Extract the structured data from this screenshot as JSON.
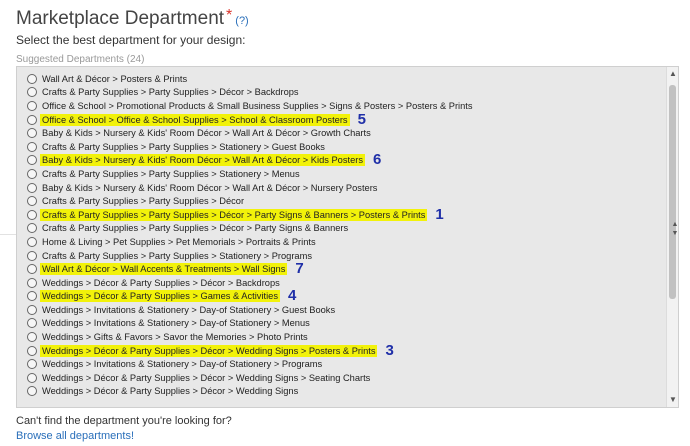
{
  "header": {
    "title": "Marketplace Department",
    "required_mark": "*",
    "help_link": "(?)"
  },
  "instruction": "Select the best department for your design:",
  "suggested_label": "Suggested Departments (24)",
  "colors": {
    "highlight": "#f2f20a",
    "badge": "#1f2fa8",
    "link": "#2a6fba",
    "required": "#d9342b"
  },
  "departments": [
    {
      "label": "Wall Art & Décor > Posters & Prints",
      "highlighted": false,
      "badge": ""
    },
    {
      "label": "Crafts & Party Supplies > Party Supplies > Décor > Backdrops",
      "highlighted": false,
      "badge": ""
    },
    {
      "label": "Office & School > Promotional Products & Small Business Supplies > Signs & Posters > Posters & Prints",
      "highlighted": false,
      "badge": ""
    },
    {
      "label": "Office & School > Office & School Supplies > School & Classroom Posters",
      "highlighted": true,
      "badge": "5"
    },
    {
      "label": "Baby & Kids > Nursery & Kids' Room Décor > Wall Art & Décor > Growth Charts",
      "highlighted": false,
      "badge": ""
    },
    {
      "label": "Crafts & Party Supplies > Party Supplies > Stationery > Guest Books",
      "highlighted": false,
      "badge": ""
    },
    {
      "label": "Baby & Kids > Nursery & Kids' Room Décor > Wall Art & Décor > Kids Posters",
      "highlighted": true,
      "badge": "6"
    },
    {
      "label": "Crafts & Party Supplies > Party Supplies > Stationery > Menus",
      "highlighted": false,
      "badge": ""
    },
    {
      "label": "Baby & Kids > Nursery & Kids' Room Décor > Wall Art & Décor > Nursery Posters",
      "highlighted": false,
      "badge": ""
    },
    {
      "label": "Crafts & Party Supplies > Party Supplies > Décor",
      "highlighted": false,
      "badge": ""
    },
    {
      "label": "Crafts & Party Supplies > Party Supplies > Décor > Party Signs & Banners > Posters & Prints",
      "highlighted": true,
      "badge": "1"
    },
    {
      "label": "Crafts & Party Supplies > Party Supplies > Décor > Party Signs & Banners",
      "highlighted": false,
      "badge": ""
    },
    {
      "label": "Home & Living > Pet Supplies > Pet Memorials > Portraits & Prints",
      "highlighted": false,
      "badge": ""
    },
    {
      "label": "Crafts & Party Supplies > Party Supplies > Stationery > Programs",
      "highlighted": false,
      "badge": ""
    },
    {
      "label": "Wall Art & Décor > Wall Accents & Treatments > Wall Signs",
      "highlighted": true,
      "badge": "7"
    },
    {
      "label": "Weddings > Décor & Party Supplies > Décor > Backdrops",
      "highlighted": false,
      "badge": ""
    },
    {
      "label": "Weddings > Décor & Party Supplies > Games & Activities",
      "highlighted": true,
      "badge": "4"
    },
    {
      "label": "Weddings > Invitations & Stationery > Day-of Stationery > Guest Books",
      "highlighted": false,
      "badge": ""
    },
    {
      "label": "Weddings > Invitations & Stationery > Day-of Stationery > Menus",
      "highlighted": false,
      "badge": ""
    },
    {
      "label": "Weddings > Gifts & Favors > Savor the Memories > Photo Prints",
      "highlighted": false,
      "badge": ""
    },
    {
      "label": "Weddings > Décor & Party Supplies > Décor > Wedding Signs > Posters & Prints",
      "highlighted": true,
      "badge": "3"
    },
    {
      "label": "Weddings > Invitations & Stationery > Day-of Stationery > Programs",
      "highlighted": false,
      "badge": ""
    },
    {
      "label": "Weddings > Décor & Party Supplies > Décor > Wedding Signs > Seating Charts",
      "highlighted": false,
      "badge": ""
    },
    {
      "label": "Weddings > Décor & Party Supplies > Décor > Wedding Signs",
      "highlighted": false,
      "badge": ""
    }
  ],
  "footer": {
    "question": "Can't find the department you're looking for?",
    "browse_link": "Browse all departments!"
  },
  "icons": {
    "scroll_up": "triangle-up",
    "scroll_down": "triangle-down"
  }
}
